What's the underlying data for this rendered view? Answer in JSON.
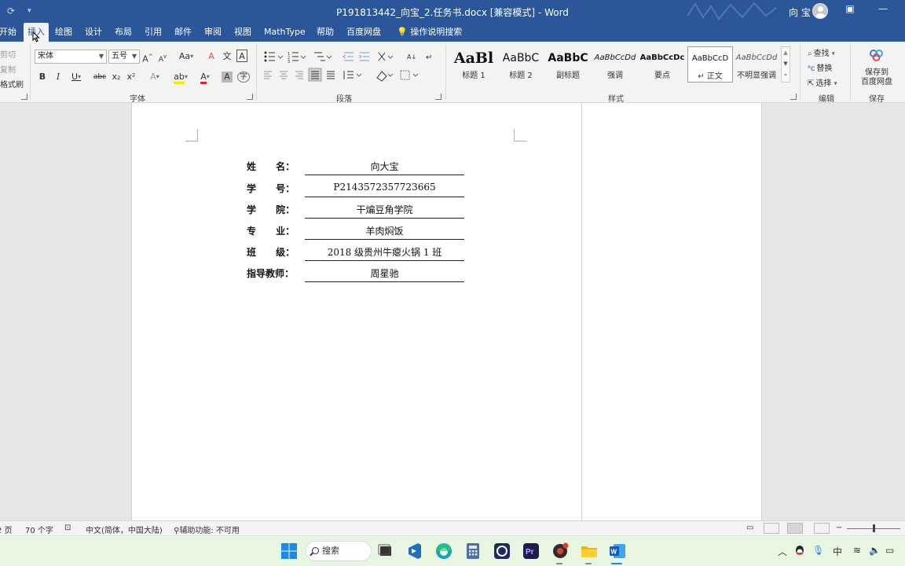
{
  "titlebar": {
    "document_title": "P191813442_向宝_2.任务书.docx [兼容模式]  -  Word",
    "user_name": "向 宝",
    "icons": [
      "sync-icon",
      "quick-access-icon",
      "avatar-icon",
      "ribbon-display-icon",
      "minimize-icon"
    ]
  },
  "tabs": [
    "开始",
    "插入",
    "绘图",
    "设计",
    "布局",
    "引用",
    "邮件",
    "审阅",
    "视图",
    "MathType",
    "帮助",
    "百度网盘"
  ],
  "tell_me": "操作说明搜索",
  "ribbon": {
    "clipboard": {
      "cut": "剪切",
      "copy": "复制",
      "painter": "格式刷"
    },
    "font": {
      "label": "字体",
      "font_name": "宋体",
      "font_size": "五号",
      "grow": "A",
      "shrink": "A",
      "change_case": "Aa",
      "clear_format": "A",
      "phonetic": "文",
      "border_char": "A",
      "bold": "B",
      "italic": "I",
      "underline": "U",
      "strike": "abc",
      "subscript": "x₂",
      "superscript": "x²",
      "text_effect": "A",
      "highlight": "ab",
      "font_color": "A",
      "char_shading": "A",
      "enclose": "字"
    },
    "paragraph": {
      "label": "段落"
    },
    "styles": {
      "label": "样式",
      "items": [
        {
          "preview": "AaBl",
          "name": "标题 1"
        },
        {
          "preview": "AaBbC",
          "name": "标题 2"
        },
        {
          "preview": "AaBbC",
          "name": "副标题"
        },
        {
          "preview": "AaBbCcDd",
          "name": "强调"
        },
        {
          "preview": "AaBbCcDc",
          "name": "要点"
        },
        {
          "preview": "AaBbCcD",
          "name": "↵ 正文"
        },
        {
          "preview": "AaBbCcDd",
          "name": "不明显强调"
        }
      ]
    },
    "editing": {
      "label": "编辑",
      "find": "查找",
      "replace": "替换",
      "select": "选择"
    },
    "save": {
      "label": "保存",
      "button": "保存到\n百度网盘"
    }
  },
  "document": {
    "fields": [
      {
        "label": "姓      名：",
        "value": "向大宝"
      },
      {
        "label": "学      号：",
        "value": "P2143572357723665"
      },
      {
        "label": "学      院：",
        "value": "干煸豆角学院"
      },
      {
        "label": "专      业：",
        "value": "羊肉焖饭"
      },
      {
        "label": "班      级：",
        "value": "2018 级贵州牛瘪火锅 1 班"
      },
      {
        "label": "指导教师：",
        "value": "周星驰"
      }
    ]
  },
  "status": {
    "page": "2 页",
    "words": "70 个字",
    "language": "中文(简体，中国大陆)",
    "accessibility": "辅助功能: 不可用"
  },
  "taskbar": {
    "search": "搜索",
    "ime": "中",
    "apps": [
      "start-icon",
      "file-explorer-task-icon",
      "vscode-icon",
      "edge-icon",
      "calculator-icon",
      "capture-icon",
      "premiere-icon",
      "chrome-like-icon",
      "folder-icon",
      "word-icon"
    ]
  }
}
